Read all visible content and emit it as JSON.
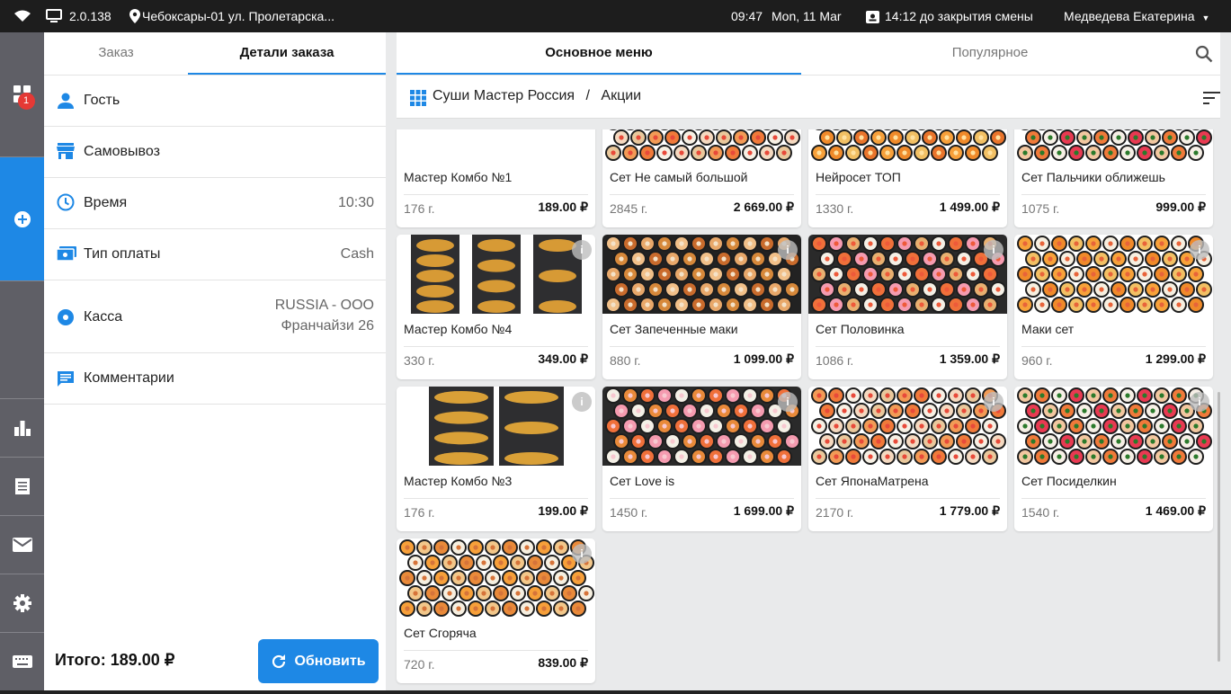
{
  "status_bar": {
    "version": "2.0.138",
    "location": "Чебоксары-01 ул. Пролетарска...",
    "time": "09:47",
    "date": "Mon, 11 Mar",
    "shift": "14:12 до закрытия смены",
    "user": "Медведева Екатерина"
  },
  "sidebar": {
    "orders_badge": "1"
  },
  "order_panel": {
    "tabs": [
      "Заказ",
      "Детали заказа"
    ],
    "rows": {
      "guest": "Гость",
      "pickup": "Самовывоз",
      "time_label": "Время",
      "time_value": "10:30",
      "payment_label": "Тип оплаты",
      "payment_value": "Cash",
      "cashier_label": "Касса",
      "cashier_value_1": "RUSSIA - ООО",
      "cashier_value_2": "Франчайзи 26",
      "comments": "Комментарии"
    },
    "total": "Итого: 189.00 ₽",
    "refresh_label": "Обновить"
  },
  "menu": {
    "tabs": [
      "Основное меню",
      "Популярное"
    ],
    "breadcrumb_root": "Суши Мастер Россия",
    "breadcrumb_sep": "/",
    "breadcrumb_current": "Акции",
    "cards": [
      {
        "name": "Мастер Комбо №1",
        "weight": "176 г.",
        "price": "189.00 ₽",
        "img": "nuggets"
      },
      {
        "name": "Сет Не самый большой",
        "weight": "2845 г.",
        "price": "2 669.00 ₽",
        "img": "rolls"
      },
      {
        "name": "Нейросет ТОП",
        "weight": "1330 г.",
        "price": "1 499.00 ₽",
        "img": "rolls-orange"
      },
      {
        "name": "Сет Пальчики оближешь",
        "weight": "1075 г.",
        "price": "999.00 ₽",
        "img": "rolls-red"
      },
      {
        "name": "Мастер Комбо №4",
        "weight": "330 г.",
        "price": "349.00 ₽",
        "img": "combo4"
      },
      {
        "name": "Сет Запеченные маки",
        "weight": "880 г.",
        "price": "1 099.00 ₽",
        "img": "baked"
      },
      {
        "name": "Сет Половинка",
        "weight": "1086 г.",
        "price": "1 359.00 ₽",
        "img": "half"
      },
      {
        "name": "Маки сет",
        "weight": "960 г.",
        "price": "1 299.00 ₽",
        "img": "maki"
      },
      {
        "name": "Мастер Комбо №3",
        "weight": "176 г.",
        "price": "199.00 ₽",
        "img": "combo3"
      },
      {
        "name": "Сет Love is",
        "weight": "1450 г.",
        "price": "1 699.00 ₽",
        "img": "love"
      },
      {
        "name": "Сет ЯпонаМатрена",
        "weight": "2170 г.",
        "price": "1 779.00 ₽",
        "img": "rolls"
      },
      {
        "name": "Сет Посиделкин",
        "weight": "1540 г.",
        "price": "1 469.00 ₽",
        "img": "rolls-red"
      },
      {
        "name": "Сет Сгоряча",
        "weight": "720 г.",
        "price": "839.00 ₽",
        "img": "hot"
      }
    ]
  },
  "colors": {
    "accent": "#1e88e5",
    "sidebar": "#5f5f66",
    "topbar": "#1d1d1d",
    "badge": "#e53935"
  }
}
